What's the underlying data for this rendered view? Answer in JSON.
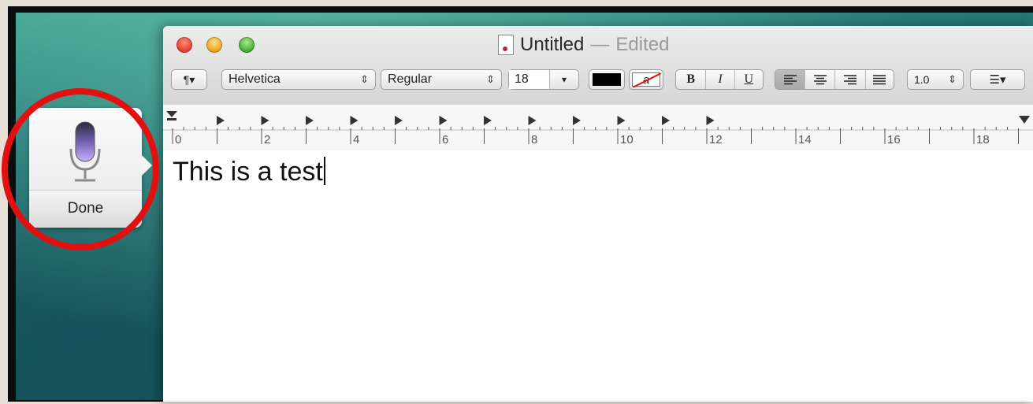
{
  "window": {
    "title": "Untitled",
    "title_separator": "—",
    "title_status": "Edited"
  },
  "toolbar": {
    "paragraph_menu": "¶▾",
    "font_family": "Helvetica",
    "font_style": "Regular",
    "font_size": "18",
    "size_arrow": "▾",
    "text_color": "#000000",
    "background_color_glyph": "a",
    "bold": "B",
    "italic": "I",
    "underline": "U",
    "line_spacing": "1.0",
    "list_menu": "☰▾",
    "updown_arrows": "⌃⌄"
  },
  "ruler": {
    "labels": [
      "0",
      "2",
      "4",
      "6",
      "8",
      "10",
      "12",
      "14",
      "16",
      "18"
    ]
  },
  "document": {
    "text": "This is a test"
  },
  "dictation": {
    "icon": "microphone-icon",
    "done_label": "Done"
  },
  "colors": {
    "highlight": "#e21010"
  }
}
